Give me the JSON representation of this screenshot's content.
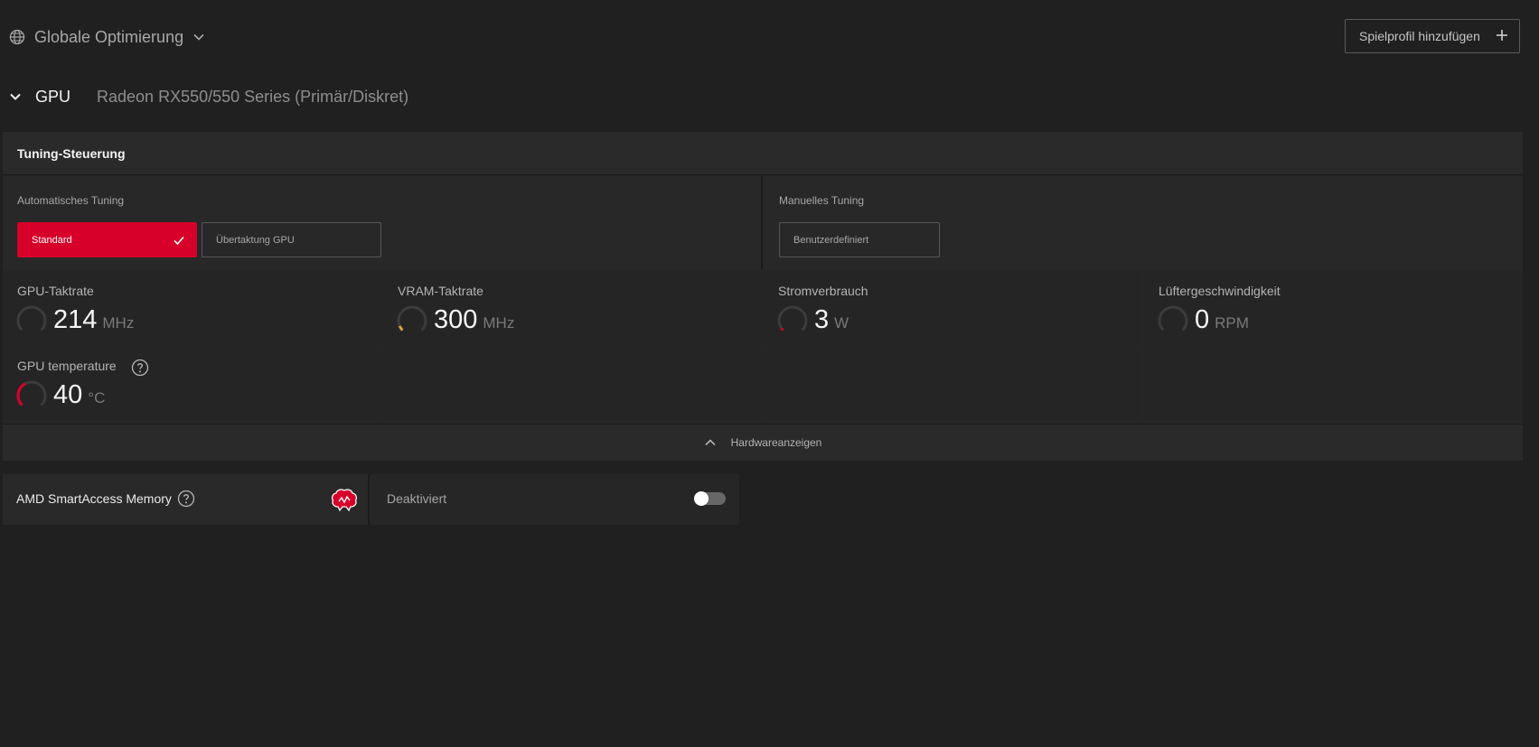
{
  "header": {
    "scope_label": "Globale Optimierung",
    "scope_icon": "globe-icon",
    "add_profile_label": "Spielprofil hinzufügen",
    "add_profile_icon": "plus-icon"
  },
  "gpu": {
    "section_label": "GPU",
    "model": "Radeon RX550/550 Series (Primär/Diskret)"
  },
  "tuning": {
    "panel_title": "Tuning-Steuerung",
    "auto": {
      "caption": "Automatisches Tuning",
      "options": [
        {
          "label": "Standard",
          "selected": true
        },
        {
          "label": "Übertaktung GPU",
          "selected": false
        }
      ]
    },
    "manual": {
      "caption": "Manuelles Tuning",
      "options": [
        {
          "label": "Benutzerdefiniert",
          "selected": false
        }
      ]
    }
  },
  "metrics": [
    {
      "name": "GPU-Taktrate",
      "value": "214",
      "unit": "MHz",
      "gauge_level": 0.0,
      "gauge_color": "#3c3c3c"
    },
    {
      "name": "VRAM-Taktrate",
      "value": "300",
      "unit": "MHz",
      "gauge_level": 0.08,
      "gauge_color": "#d9a441"
    },
    {
      "name": "Stromverbrauch",
      "value": "3",
      "unit": "W",
      "gauge_level": 0.03,
      "gauge_color": "#d7002a"
    },
    {
      "name": "Lüftergeschwindigkeit",
      "value": "0",
      "unit": "RPM",
      "gauge_level": 0.0,
      "gauge_color": "#3c3c3c"
    },
    {
      "name": "GPU temperature",
      "value": "40",
      "unit": "°C",
      "gauge_level": 0.4,
      "gauge_color": "#d7002a",
      "help": true
    }
  ],
  "hardware_toggle": {
    "label": "Hardwareanzeigen",
    "icon": "chevron-up-icon"
  },
  "smart_access": {
    "label": "AMD SmartAccess Memory",
    "status": "Deaktiviert",
    "enabled": false,
    "icon": "brain-icon",
    "accent": "#d7002a"
  }
}
